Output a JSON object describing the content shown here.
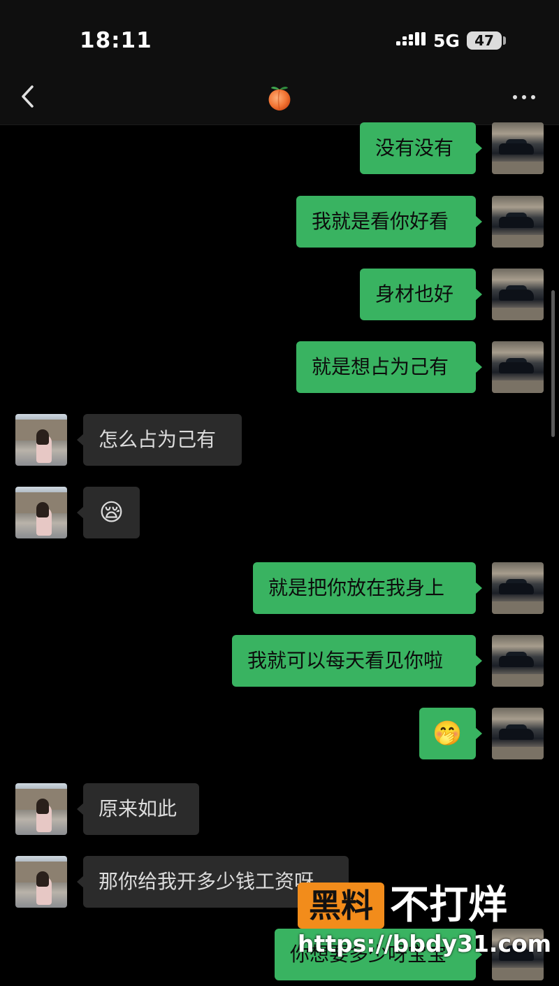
{
  "status_bar": {
    "time": "18:11",
    "network": "5G",
    "battery": "47"
  },
  "header": {
    "title_icon": "peach-emoji",
    "title_emoji": "🍑",
    "back_icon": "chevron-left-icon",
    "more_icon": "more-dots-icon"
  },
  "messages": [
    {
      "side": "out",
      "text": "没有没有"
    },
    {
      "side": "out",
      "text": "我就是看你好看"
    },
    {
      "side": "out",
      "text": "身材也好"
    },
    {
      "side": "out",
      "text": "就是想占为己有"
    },
    {
      "side": "in",
      "text": "怎么占为己有"
    },
    {
      "side": "in",
      "text": "😪"
    },
    {
      "side": "out",
      "text": "就是把你放在我身上"
    },
    {
      "side": "out",
      "text": "我就可以每天看见你啦"
    },
    {
      "side": "out",
      "text": "🤭"
    },
    {
      "side": "in",
      "text": "原来如此"
    },
    {
      "side": "in",
      "text": "那你给我开多少钱工资呀"
    },
    {
      "side": "out",
      "text": "你想要多少呀宝宝"
    }
  ],
  "watermark": {
    "badge": "黑料",
    "text": "不打烊",
    "url": "https://bbdy31.com"
  },
  "colors": {
    "outgoing_bubble": "#39b361",
    "incoming_bubble": "#2b2b2b",
    "background": "#000000",
    "watermark_accent": "#f28c1b"
  }
}
